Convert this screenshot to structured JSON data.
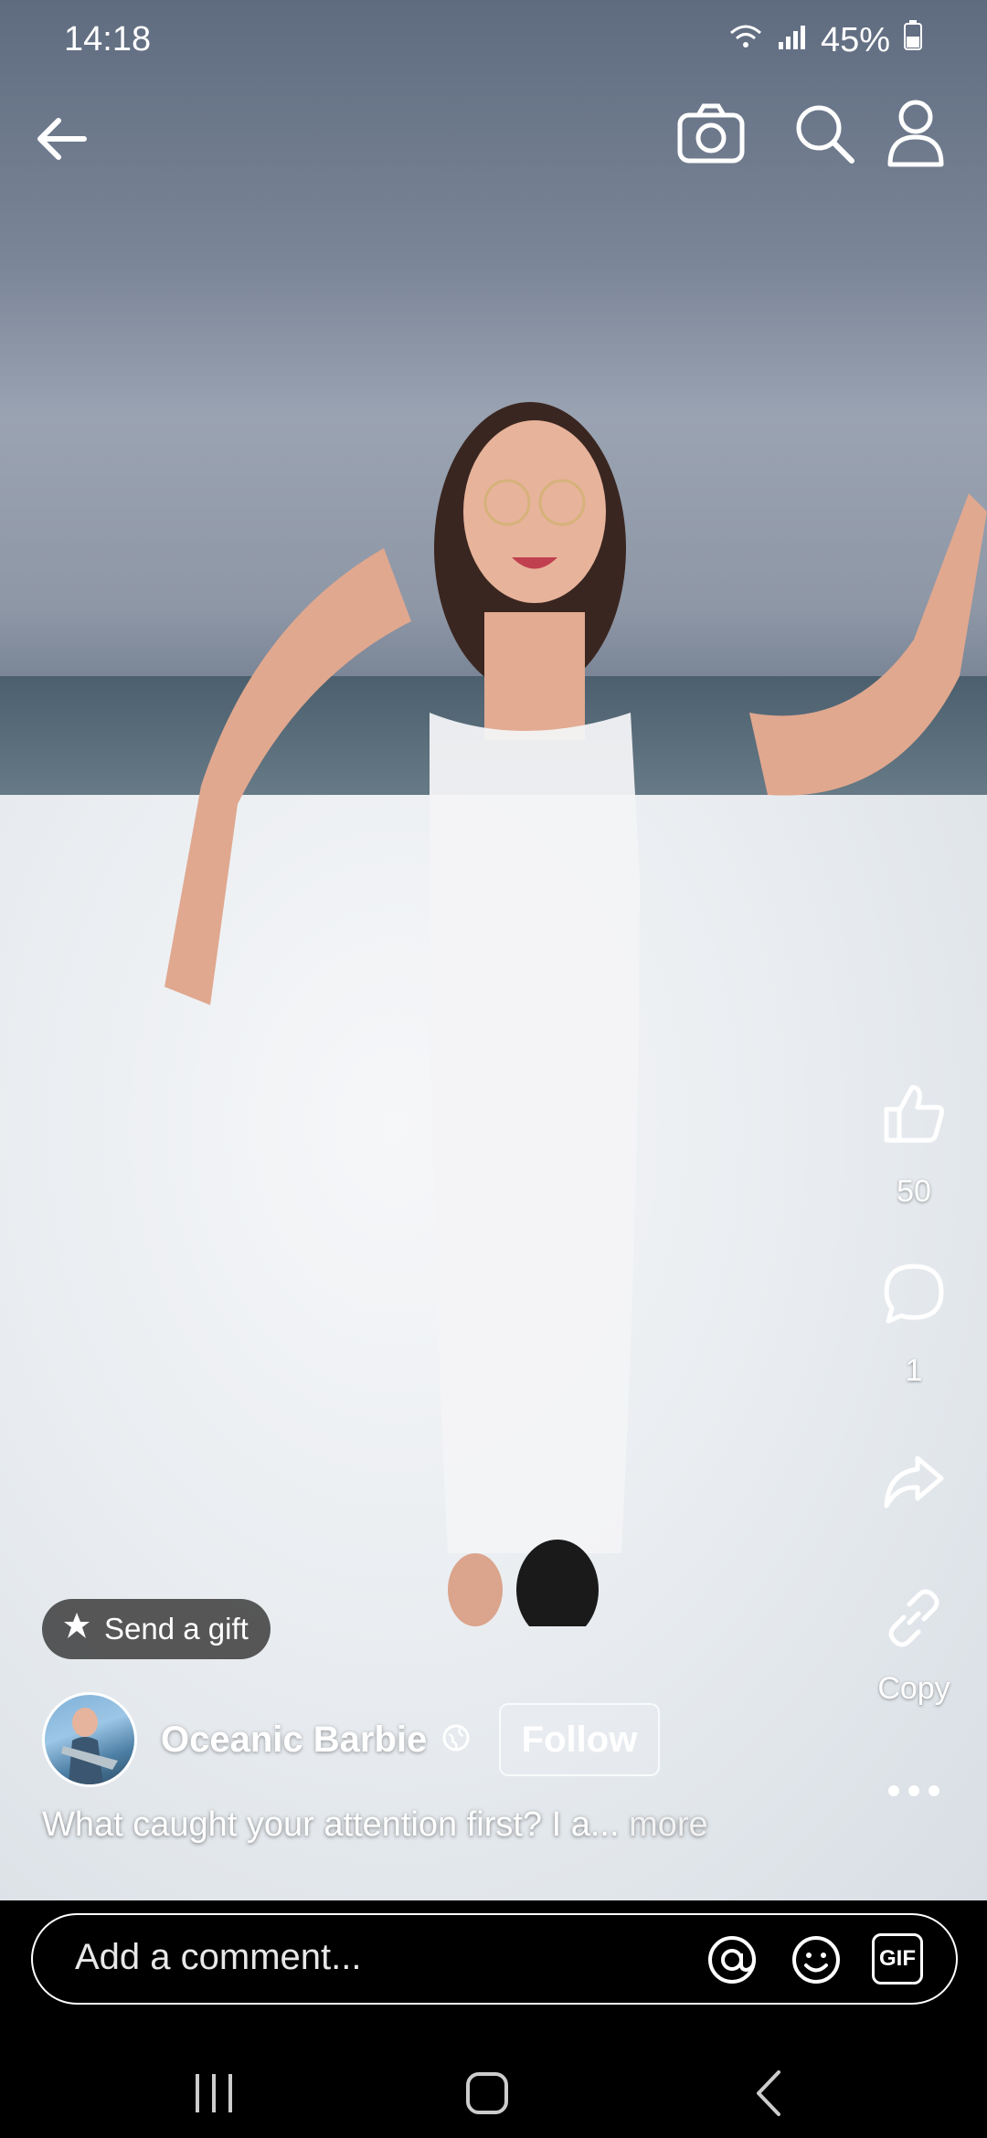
{
  "status_bar": {
    "time": "14:18",
    "battery": "45%"
  },
  "top_bar": {
    "back_icon": "arrow-left-icon",
    "camera_icon": "camera-icon",
    "search_icon": "search-icon",
    "profile_icon": "person-icon"
  },
  "actions": {
    "like": {
      "icon": "thumbs-up-icon",
      "count": "50"
    },
    "comment": {
      "icon": "speech-bubble-icon",
      "count": "1"
    },
    "share": {
      "icon": "share-arrow-icon"
    },
    "copy": {
      "icon": "link-icon",
      "label": "Copy"
    },
    "more": {
      "icon": "more-dots-icon"
    }
  },
  "gift": {
    "label": "Send a gift"
  },
  "author": {
    "name": "Oceanic Barbie",
    "follow_label": "Follow"
  },
  "caption": {
    "text": "What caught your attention first? I a...",
    "more": "more"
  },
  "comment_bar": {
    "placeholder": "Add a comment...",
    "gif_label": "GIF"
  },
  "colors": {
    "overlay_text": "#ffffff",
    "bar_bg": "#000000"
  }
}
